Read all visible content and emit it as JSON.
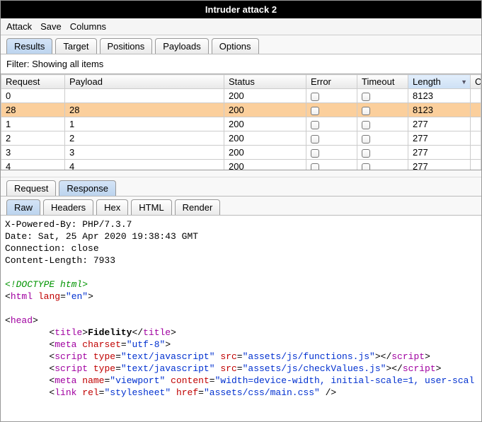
{
  "window": {
    "title": "Intruder attack 2"
  },
  "menu": {
    "items": [
      "Attack",
      "Save",
      "Columns"
    ]
  },
  "mainTabs": {
    "items": [
      "Results",
      "Target",
      "Positions",
      "Payloads",
      "Options"
    ],
    "active": 0
  },
  "filter": {
    "text": "Filter: Showing all items"
  },
  "columns": {
    "headers": [
      "Request",
      "Payload",
      "Status",
      "Error",
      "Timeout",
      "Length",
      "Comm"
    ],
    "sortedIndex": 5
  },
  "rows": [
    {
      "request": "0",
      "payload": "",
      "status": "200",
      "error": false,
      "timeout": false,
      "length": "8123",
      "selected": false
    },
    {
      "request": "28",
      "payload": "28",
      "status": "200",
      "error": false,
      "timeout": false,
      "length": "8123",
      "selected": true
    },
    {
      "request": "1",
      "payload": "1",
      "status": "200",
      "error": false,
      "timeout": false,
      "length": "277",
      "selected": false
    },
    {
      "request": "2",
      "payload": "2",
      "status": "200",
      "error": false,
      "timeout": false,
      "length": "277",
      "selected": false
    },
    {
      "request": "3",
      "payload": "3",
      "status": "200",
      "error": false,
      "timeout": false,
      "length": "277",
      "selected": false
    },
    {
      "request": "4",
      "payload": "4",
      "status": "200",
      "error": false,
      "timeout": false,
      "length": "277",
      "selected": false
    }
  ],
  "detailTabs": {
    "items": [
      "Request",
      "Response"
    ],
    "active": 1
  },
  "viewTabs": {
    "items": [
      "Raw",
      "Headers",
      "Hex",
      "HTML",
      "Render"
    ],
    "active": 0
  },
  "response": {
    "headers": {
      "x_powered": "X-Powered-By: PHP/7.3.7",
      "date": "Date: Sat, 25 Apr 2020 19:38:43 GMT",
      "connection": "Connection: close",
      "content_length": "Content-Length: 7933"
    },
    "body": {
      "doctype": "<!DOCTYPE html>",
      "html_open": {
        "tag": "html",
        "attr": "lang",
        "val": "en"
      },
      "head_open": {
        "tag": "head"
      },
      "title": {
        "text": "Fidelity"
      },
      "meta_charset": {
        "attr": "charset",
        "val": "utf-8"
      },
      "script1": {
        "attr_type": "type",
        "val_type": "text/javascript",
        "attr_src": "src",
        "val_src": "assets/js/functions.js"
      },
      "script2": {
        "attr_type": "type",
        "val_type": "text/javascript",
        "attr_src": "src",
        "val_src": "assets/js/checkValues.js"
      },
      "meta_vp": {
        "attr_name": "name",
        "val_name": "viewport",
        "attr_content": "content",
        "val_content": "width=device-width, initial-scale=1, user-scal"
      },
      "link": {
        "attr_rel": "rel",
        "val_rel": "stylesheet",
        "attr_href": "href",
        "val_href": "assets/css/main.css"
      }
    }
  }
}
